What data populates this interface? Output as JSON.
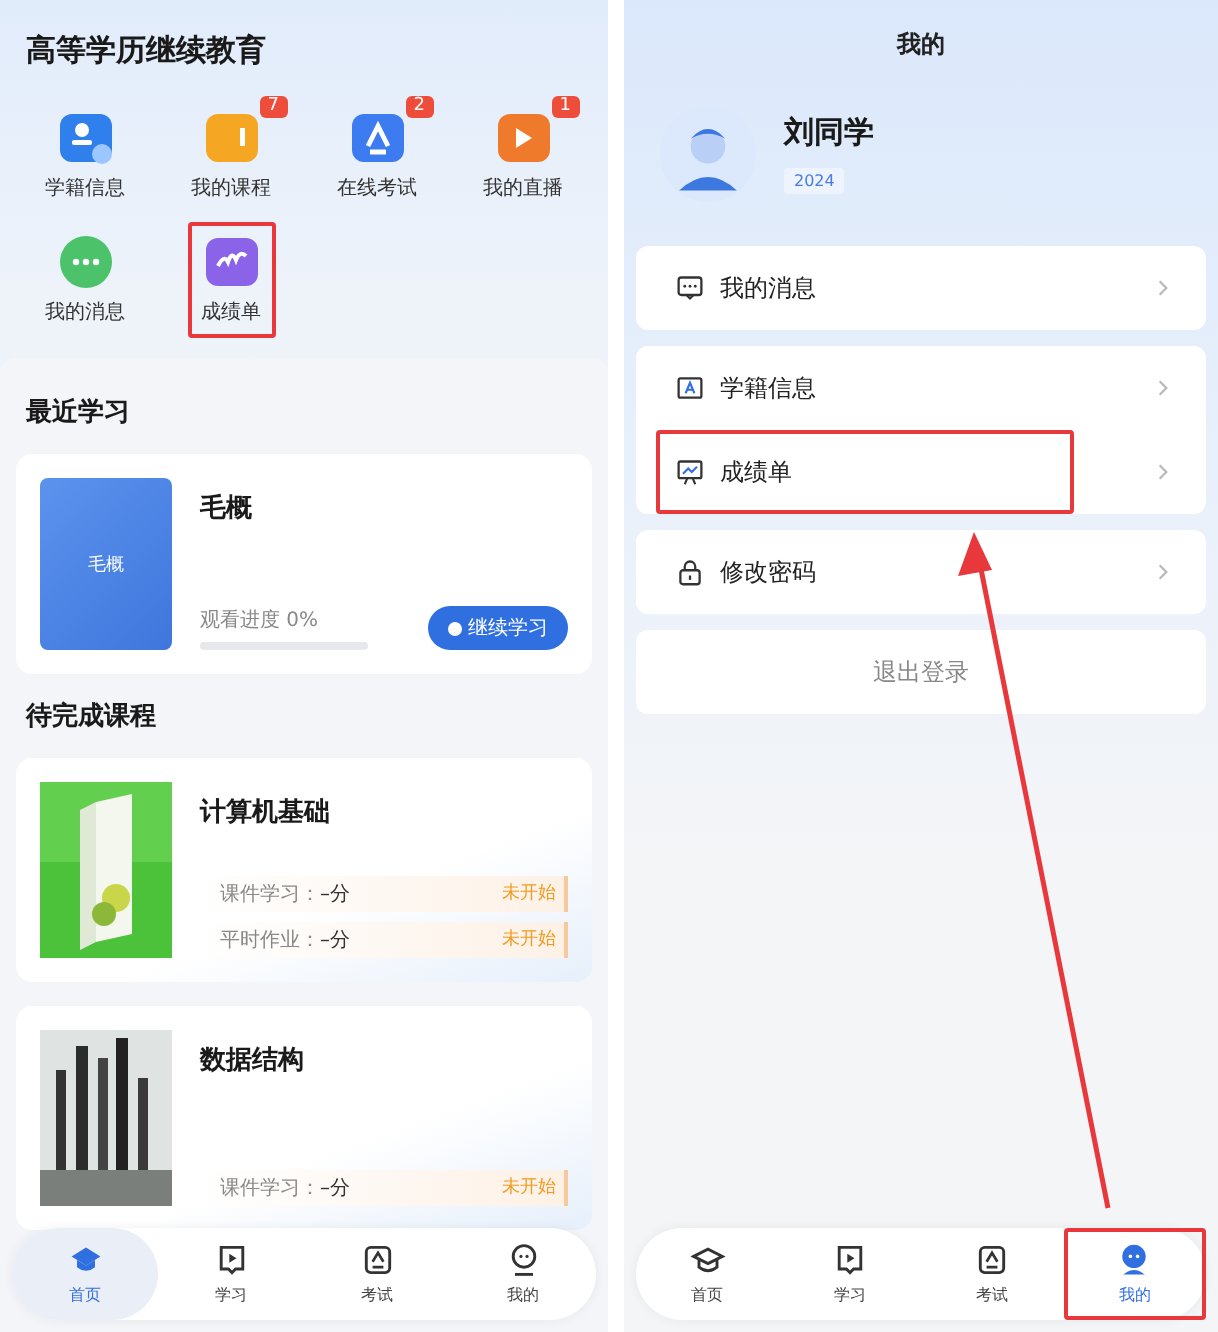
{
  "left_screen": {
    "title": "高等学历继续教育",
    "shortcuts": [
      {
        "label": "学籍信息",
        "highlighted": false
      },
      {
        "label": "我的课程",
        "badge": "7",
        "highlighted": false
      },
      {
        "label": "在线考试",
        "badge": "2",
        "highlighted": false
      },
      {
        "label": "我的直播",
        "badge": "1",
        "highlighted": false
      },
      {
        "label": "我的消息",
        "highlighted": false
      },
      {
        "label": "成绩单",
        "highlighted": true
      }
    ],
    "recent": {
      "heading": "最近学习",
      "cover_title": "毛概",
      "title": "毛概",
      "progress_label": "观看进度 0%",
      "level": 0,
      "button": "继续学习"
    },
    "pending": {
      "heading": "待完成课程",
      "courses": [
        {
          "title": "计算机基础",
          "rows": [
            {
              "label": "课件学习：",
              "score": "–分",
              "status": "未开始"
            },
            {
              "label": "平时作业：",
              "score": "–分",
              "status": "未开始"
            }
          ]
        },
        {
          "title": "数据结构",
          "rows": [
            {
              "label": "课件学习：",
              "score": "–分",
              "status": "未开始"
            }
          ]
        }
      ]
    },
    "tab_bar": [
      {
        "label": "首页",
        "selected": true,
        "highlighted": false
      },
      {
        "label": "学习",
        "selected": false,
        "highlighted": false
      },
      {
        "label": "考试",
        "selected": false,
        "highlighted": false
      },
      {
        "label": "我的",
        "selected": false,
        "highlighted": false
      }
    ]
  },
  "right_screen": {
    "title": "我的",
    "user": {
      "name": "刘同学",
      "tag": "2024"
    },
    "menu_groups": [
      [
        {
          "label": "我的消息",
          "highlighted": false
        }
      ],
      [
        {
          "label": "学籍信息",
          "highlighted": false
        },
        {
          "label": "成绩单",
          "highlighted": true
        }
      ],
      [
        {
          "label": "修改密码",
          "highlighted": false
        }
      ]
    ],
    "logout": "退出登录",
    "tab_bar": [
      {
        "label": "首页",
        "selected": false,
        "highlighted": false
      },
      {
        "label": "学习",
        "selected": false,
        "highlighted": false
      },
      {
        "label": "考试",
        "selected": false,
        "highlighted": false
      },
      {
        "label": "我的",
        "selected": true,
        "highlighted": true
      }
    ]
  }
}
